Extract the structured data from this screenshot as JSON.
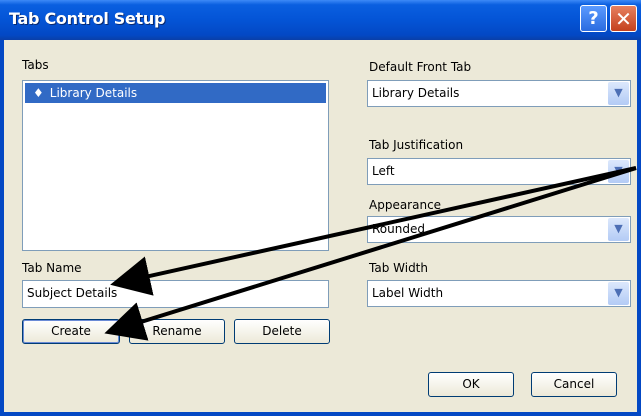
{
  "window": {
    "title": "Tab Control Setup",
    "help_label": "?",
    "close_label": "✕"
  },
  "tabs_section": {
    "label": "Tabs",
    "items": [
      {
        "bullet": "♦",
        "label": "Library Details",
        "selected": true
      }
    ]
  },
  "tab_name": {
    "label": "Tab Name",
    "value": "Subject Details"
  },
  "buttons": {
    "create": "Create",
    "rename": "Rename",
    "delete": "Delete",
    "ok": "OK",
    "cancel": "Cancel"
  },
  "default_front_tab": {
    "label": "Default Front Tab",
    "value": "Library Details"
  },
  "tab_justification": {
    "label": "Tab Justification",
    "value": "Left"
  },
  "appearance": {
    "label": "Appearance",
    "value": "Rounded"
  },
  "tab_width": {
    "label": "Tab Width",
    "value": "Label Width"
  },
  "colors": {
    "titlebar": "#0454d6",
    "selection": "#316ac5",
    "dialog_bg": "#ece9d8",
    "arrow": "#000000"
  }
}
